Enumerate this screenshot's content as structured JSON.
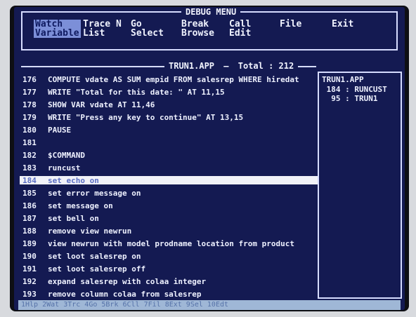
{
  "window": {
    "title": "DEBUG MENU"
  },
  "menu": [
    {
      "id": "variable",
      "line1": "Watch",
      "line2": "Variable",
      "selected": true
    },
    {
      "id": "trace",
      "line1": "Trace N",
      "line2": "List",
      "selected": false
    },
    {
      "id": "go",
      "line1": "Go",
      "line2": "Select",
      "selected": false
    },
    {
      "id": "break",
      "line1": "Break",
      "line2": "Browse",
      "selected": false
    },
    {
      "id": "call",
      "line1": "Call",
      "line2": "Edit",
      "selected": false
    },
    {
      "id": "file",
      "line1": "File",
      "line2": "",
      "selected": false
    },
    {
      "id": "exit",
      "line1": "Exit",
      "line2": "",
      "selected": false
    }
  ],
  "editor": {
    "file_label": "TRUN1.APP",
    "separator": "—",
    "total_label": "Total : 212",
    "lines": [
      {
        "num": "176",
        "text": "COMPUTE vdate AS SUM empid FROM salesrep WHERE hiredat"
      },
      {
        "num": "177",
        "text": "WRITE \"Total for this date: \" AT 11,15"
      },
      {
        "num": "178",
        "text": "SHOW VAR vdate AT 11,46"
      },
      {
        "num": "179",
        "text": "WRITE \"Press any key to continue\" AT 13,15"
      },
      {
        "num": "180",
        "text": "PAUSE"
      },
      {
        "num": "181",
        "text": ""
      },
      {
        "num": "182",
        "text": "$COMMAND"
      },
      {
        "num": "183",
        "text": "runcust"
      },
      {
        "num": "184",
        "text": "set echo on",
        "highlight": true
      },
      {
        "num": "185",
        "text": "set error message on"
      },
      {
        "num": "186",
        "text": "set message on"
      },
      {
        "num": "187",
        "text": "set bell on"
      },
      {
        "num": "188",
        "text": "remove view newrun"
      },
      {
        "num": "189",
        "text": "view newrun with model prodname location from product"
      },
      {
        "num": "190",
        "text": "set loot salesrep on"
      },
      {
        "num": "191",
        "text": "set loot salesrep off"
      },
      {
        "num": "192",
        "text": "expand salesrep with colaa integer"
      },
      {
        "num": "193",
        "text": "remove column colaa from salesrep"
      }
    ]
  },
  "call_stack": {
    "title": "TRUN1.APP",
    "entries": [
      {
        "line": "184",
        "name": "RUNCUST"
      },
      {
        "line": "95",
        "name": "TRUN1"
      }
    ]
  },
  "status_bar": {
    "text": "1Hlp 2Wat 3Trc 4Go 5Brk 6Cll 7Fil 8Ext 9Sel 10Edt"
  }
}
